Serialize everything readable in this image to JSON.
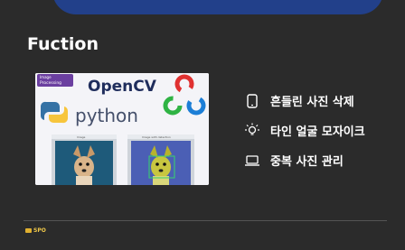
{
  "header": {
    "color": "#22408a"
  },
  "section": {
    "title": "Fuction"
  },
  "banner": {
    "badge_line1": "Image",
    "badge_line2": "Processing",
    "opencv_label": "OpenCV",
    "python_label": "python",
    "window_title_left": "Image",
    "window_title_right": "Image with detection"
  },
  "features": [
    {
      "icon": "smartphone-icon",
      "label": "흔들린 사진 삭제"
    },
    {
      "icon": "lightbulb-icon",
      "label": "타인 얼굴 모자이크"
    },
    {
      "icon": "laptop-icon",
      "label": "중복 사진 관리"
    }
  ],
  "footer": {
    "label": "SPO",
    "icon": "folder-icon"
  },
  "colors": {
    "background": "#2b2b2b",
    "accent": "#22408a",
    "footer_text": "#f0c94a"
  }
}
